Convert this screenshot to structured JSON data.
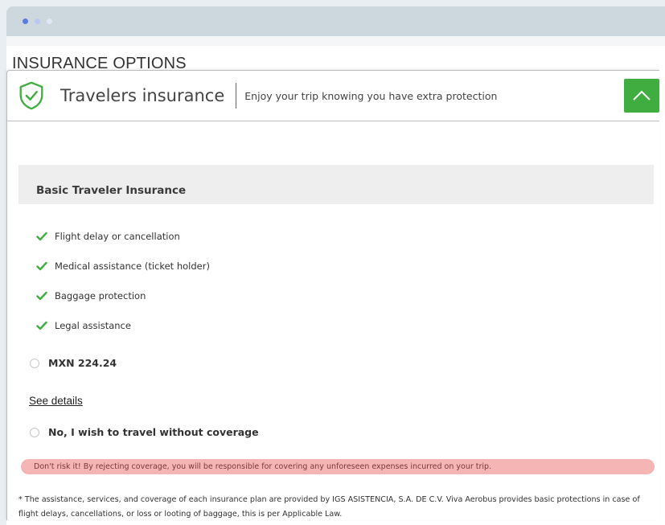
{
  "window": {
    "colors": {
      "titlebar": "#cdd8de",
      "accent": "#3fad3f",
      "warning_bg": "#f5b5b5"
    }
  },
  "page": {
    "heading": "INSURANCE OPTIONS"
  },
  "card": {
    "icon": "shield-check-icon",
    "title": "Travelers insurance",
    "subtitle": "Enjoy your trip knowing you have extra protection",
    "collapse_icon": "chevron-up-icon"
  },
  "plan": {
    "title": "Basic Traveler Insurance",
    "features": [
      "Flight delay or cancellation",
      "Medical assistance (ticket holder)",
      "Baggage protection",
      "Legal assistance"
    ],
    "price_option": "MXN 224.24",
    "see_details": "See details",
    "decline_option": "No, I wish to travel without coverage",
    "warning": "Don't risk it! By rejecting coverage, you will be responsible for covering any unforeseen expenses incurred on your trip.",
    "footnote": "* The assistance, services, and coverage of each insurance plan are provided by IGS ASISTENCIA, S.A. DE C.V. Viva Aerobus provides basic protections in case of flight delays, cancellations, or loss or looting of baggage, this is per Applicable Law."
  }
}
